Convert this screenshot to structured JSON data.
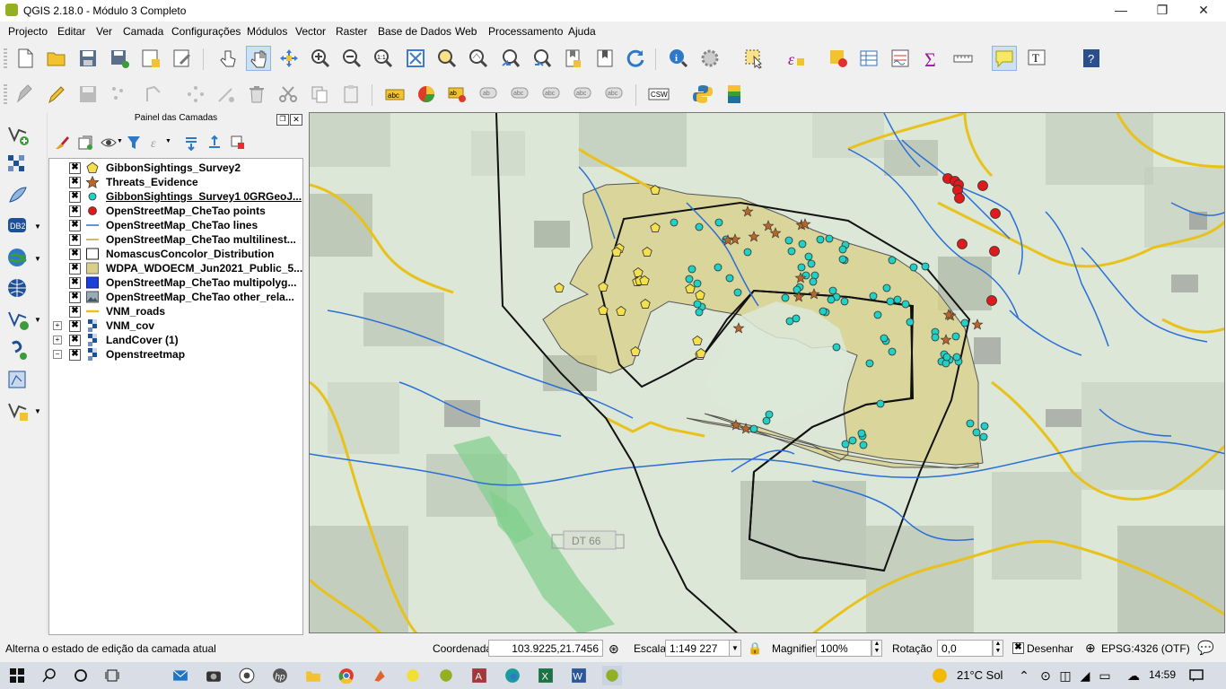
{
  "window": {
    "title": "QGIS 2.18.0 - Módulo 3 Completo",
    "minimize": "—",
    "maximize": "❐",
    "close": "✕"
  },
  "menu": [
    "Projecto",
    "Editar",
    "Ver",
    "Camada",
    "Configurações",
    "Módulos",
    "Vector",
    "Raster",
    "Base de Dados",
    "Web",
    "Processamento",
    "Ajuda"
  ],
  "layers_panel": {
    "title": "Painel das Camadas",
    "layers": [
      {
        "name": "GibbonSightings_Survey2",
        "checked": "✖",
        "symbol": "pentagon-yellow"
      },
      {
        "name": "Threats_Evidence",
        "checked": "✖",
        "symbol": "star-brown"
      },
      {
        "name": "GibbonSightings_Survey1 0GRGeoJ...",
        "checked": "✖",
        "symbol": "circle-cyan"
      },
      {
        "name": "OpenStreetMap_CheTao points",
        "checked": "✖",
        "symbol": "circle-red"
      },
      {
        "name": "OpenStreetMap_CheTao lines",
        "checked": "✖",
        "symbol": "line-blue"
      },
      {
        "name": "OpenStreetMap_CheTao multilinest...",
        "checked": "✖",
        "symbol": "line-tan"
      },
      {
        "name": "NomascusConcolor_Distribution",
        "checked": "✖",
        "symbol": "box-white"
      },
      {
        "name": "WDPA_WDOECM_Jun2021_Public_5...",
        "checked": "✖",
        "symbol": "box-khaki"
      },
      {
        "name": "OpenStreetMap_CheTao multipolyg...",
        "checked": "✖",
        "symbol": "box-blue"
      },
      {
        "name": "OpenStreetMap_CheTao other_rela...",
        "checked": "✖",
        "symbol": "raster-icon"
      },
      {
        "name": "VNM_roads",
        "checked": "✖",
        "symbol": "line-yellow"
      },
      {
        "name": "VNM_cov",
        "checked": "✖",
        "symbol": "raster-grid"
      },
      {
        "name": "LandCover (1)",
        "checked": "✖",
        "symbol": "raster-grid"
      },
      {
        "name": "Openstreetmap",
        "checked": "✖",
        "symbol": "raster-grid"
      }
    ]
  },
  "map": {
    "road_label": "DT 66",
    "colors": {
      "protected_area": "#d9cf86",
      "roads": "#e8c21a",
      "rivers": "#2a6fd6",
      "gibbon_s1": "#1fd1c6",
      "gibbon_s2": "#f4e04d",
      "threats": "#b7652a",
      "osm_points": "#e01a1a"
    }
  },
  "status": {
    "message": "Alterna o estado de edição da camada atual",
    "coord_label": "Coordenada",
    "coord_value": "103.9225,21.7456",
    "scale_label": "Escala",
    "scale_value": "1:149 227",
    "magnifier_label": "Magnifier",
    "magnifier_value": "100%",
    "rotation_label": "Rotação",
    "rotation_value": "0,0",
    "render_label": "Desenhar",
    "render_checked": "✖",
    "crs": "EPSG:4326 (OTF)"
  },
  "taskbar": {
    "weather": "21°C  Sol",
    "time": "14:59"
  }
}
